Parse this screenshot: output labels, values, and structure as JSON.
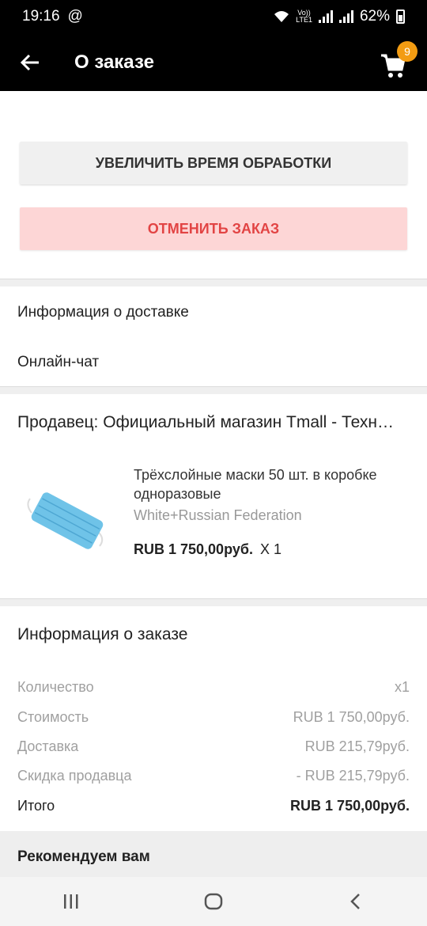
{
  "status_bar": {
    "time": "19:16",
    "carrier_icon": "at-icon",
    "volte_top": "Vo))",
    "volte_bottom": "LTE1",
    "battery_percent": "62%"
  },
  "header": {
    "title": "О заказе",
    "cart_count": "9"
  },
  "actions": {
    "extend_label": "УВЕЛИЧИТЬ ВРЕМЯ ОБРАБОТКИ",
    "cancel_label": "ОТМЕНИТЬ ЗАКАЗ"
  },
  "links": {
    "delivery_info": "Информация о доставке",
    "online_chat": "Онлайн-чат"
  },
  "seller": {
    "name": "Продавец: Официальный магазин Tmall - Техн…",
    "product": {
      "title": "Трёхслойные маски 50 шт. в коробке одноразовые",
      "variant": "White+Russian Federation",
      "price": "RUB 1 750,00руб.",
      "quantity": "X 1"
    }
  },
  "order_info": {
    "title": "Информация о заказе",
    "rows": [
      {
        "label": "Количество",
        "value": "x1"
      },
      {
        "label": "Стоимость",
        "value": "RUB 1 750,00руб."
      },
      {
        "label": "Доставка",
        "value": "RUB 215,79руб."
      },
      {
        "label": "Скидка продавца",
        "value": "- RUB 215,79руб."
      }
    ],
    "total_label": "Итого",
    "total_value": "RUB 1 750,00руб."
  },
  "recommend": {
    "title": "Рекомендуем вам"
  },
  "colors": {
    "accent_badge": "#f39c12",
    "cancel_bg": "#fdd6d6",
    "cancel_text": "#e24444"
  }
}
